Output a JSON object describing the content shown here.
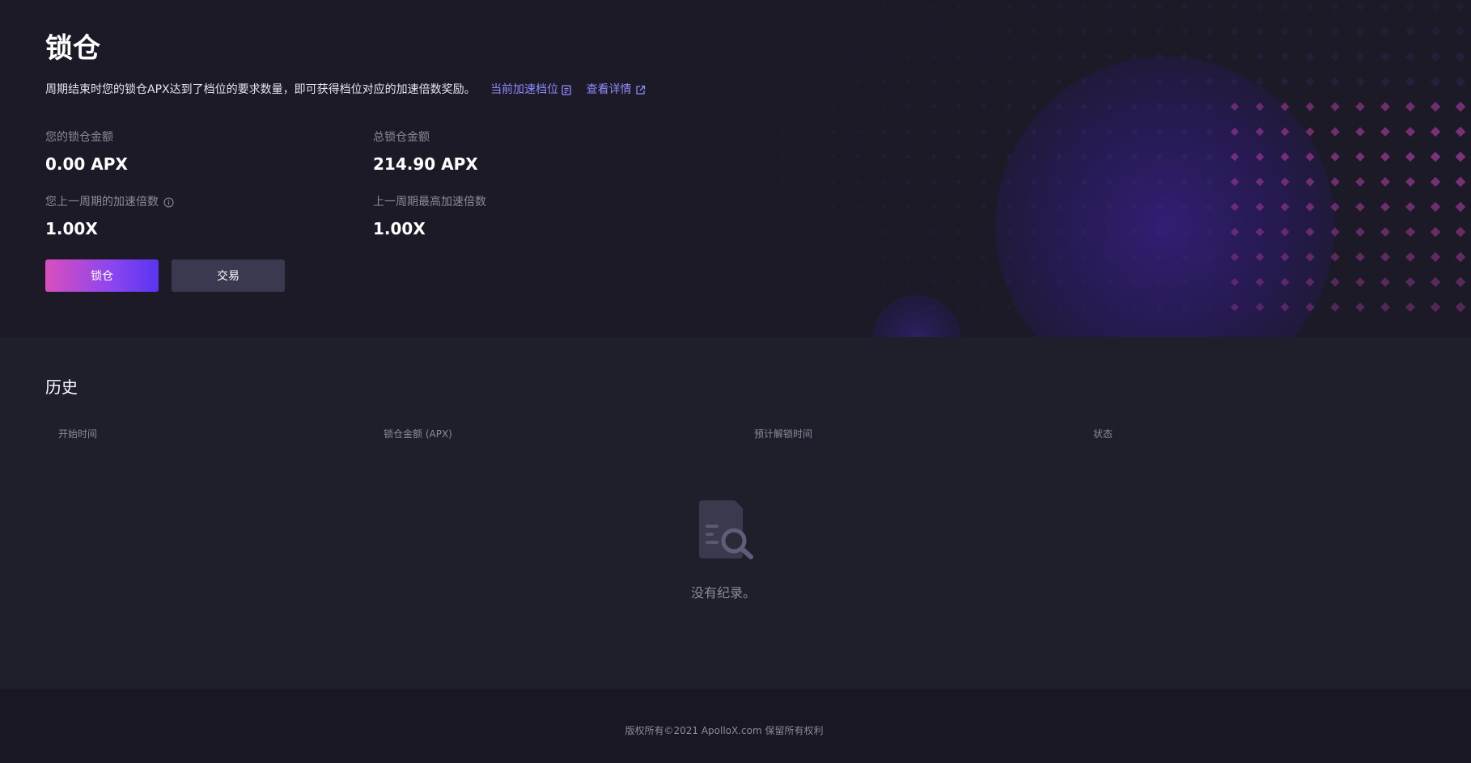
{
  "page": {
    "title": "锁仓",
    "description": "周期结束时您的锁仓APX达到了档位的要求数量，即可获得档位对应的加速倍数奖励。",
    "link_tiers": "当前加速档位",
    "link_details": "查看详情"
  },
  "stats": {
    "my_locked_label": "您的锁仓金额",
    "my_locked_value": "0.00 APX",
    "total_locked_label": "总锁仓金额",
    "total_locked_value": "214.90 APX",
    "my_multiplier_label": "您上一周期的加速倍数",
    "my_multiplier_value": "1.00X",
    "max_multiplier_label": "上一周期最高加速倍数",
    "max_multiplier_value": "1.00X"
  },
  "buttons": {
    "lock": "锁仓",
    "trade": "交易"
  },
  "history": {
    "title": "历史",
    "columns": [
      "开始时间",
      "锁仓金额 (APX)",
      "预计解锁时间",
      "状态"
    ],
    "empty_text": "没有纪录。"
  },
  "footer": {
    "copyright": "版权所有©2021 ApolloX.com 保留所有权利"
  },
  "colors": {
    "accent": "#8f8bff",
    "primary_gradient_start": "#d94fbc",
    "primary_gradient_end": "#5a35f0"
  },
  "icons": {
    "tiers_link_icon": "document-icon",
    "details_link_icon": "external-link-icon",
    "multiplier_info_icon": "info-icon",
    "empty_state_icon": "search-document-icon"
  }
}
